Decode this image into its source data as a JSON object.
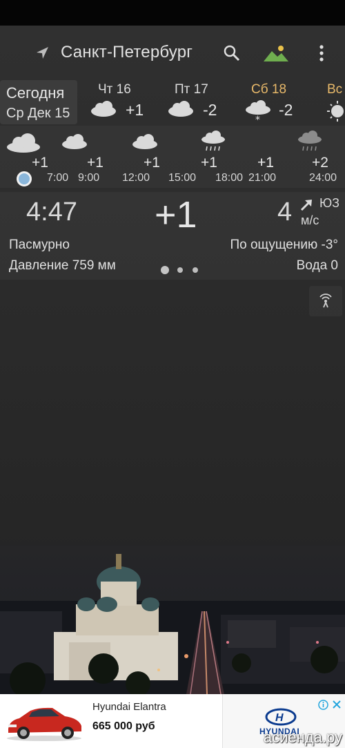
{
  "toolbar": {
    "city": "Санкт-Петербург",
    "icons": [
      "location-arrow-icon",
      "search-icon",
      "photo-icon",
      "more-vert-icon"
    ]
  },
  "today": {
    "label": "Сегодня",
    "date": "Ср Дек 15"
  },
  "days": [
    {
      "name": "Чт 16",
      "temp": "+1",
      "icon": "cloud-icon"
    },
    {
      "name": "Пт 17",
      "temp": "-2",
      "icon": "cloud-icon"
    },
    {
      "name": "Сб 18",
      "temp": "-2",
      "icon": "cloud-snow-icon"
    },
    {
      "name": "Вс",
      "temp": "",
      "icon": "sun-icon"
    }
  ],
  "hourly": [
    {
      "temp": "+1",
      "time": "7:00",
      "icon": "cloud-icon"
    },
    {
      "temp": "+1",
      "time": "9:00",
      "icon": "cloud-icon"
    },
    {
      "temp": "+1",
      "time": "12:00",
      "icon": "cloud-icon"
    },
    {
      "temp": "+1",
      "time": "15:00",
      "icon": "cloud-rain-icon"
    },
    {
      "temp": "+1",
      "time": "18:00",
      "icon": ""
    },
    {
      "temp": "+1",
      "time": "21:00",
      "icon": "cloud-rain-icon"
    },
    {
      "temp": "+2",
      "time": "24:00",
      "icon": ""
    }
  ],
  "current": {
    "time": "4:47",
    "temp": "+1",
    "wind_speed": "4",
    "wind_dir": "ЮЗ",
    "wind_unit": "м/с",
    "condition": "Пасмурно",
    "feels_like": "По ощущению -3°",
    "pressure": "Давление 759 мм",
    "water": "Вода 0"
  },
  "ad": {
    "title": "Hyundai Elantra",
    "price": "665 000 руб",
    "brand": "HYUNDAI"
  },
  "watermark": "асиенда.ру",
  "colors": {
    "accent_sat": "#e8b96a",
    "now_dot": "#8ab6da",
    "photo_icon": "#6fae4f"
  }
}
